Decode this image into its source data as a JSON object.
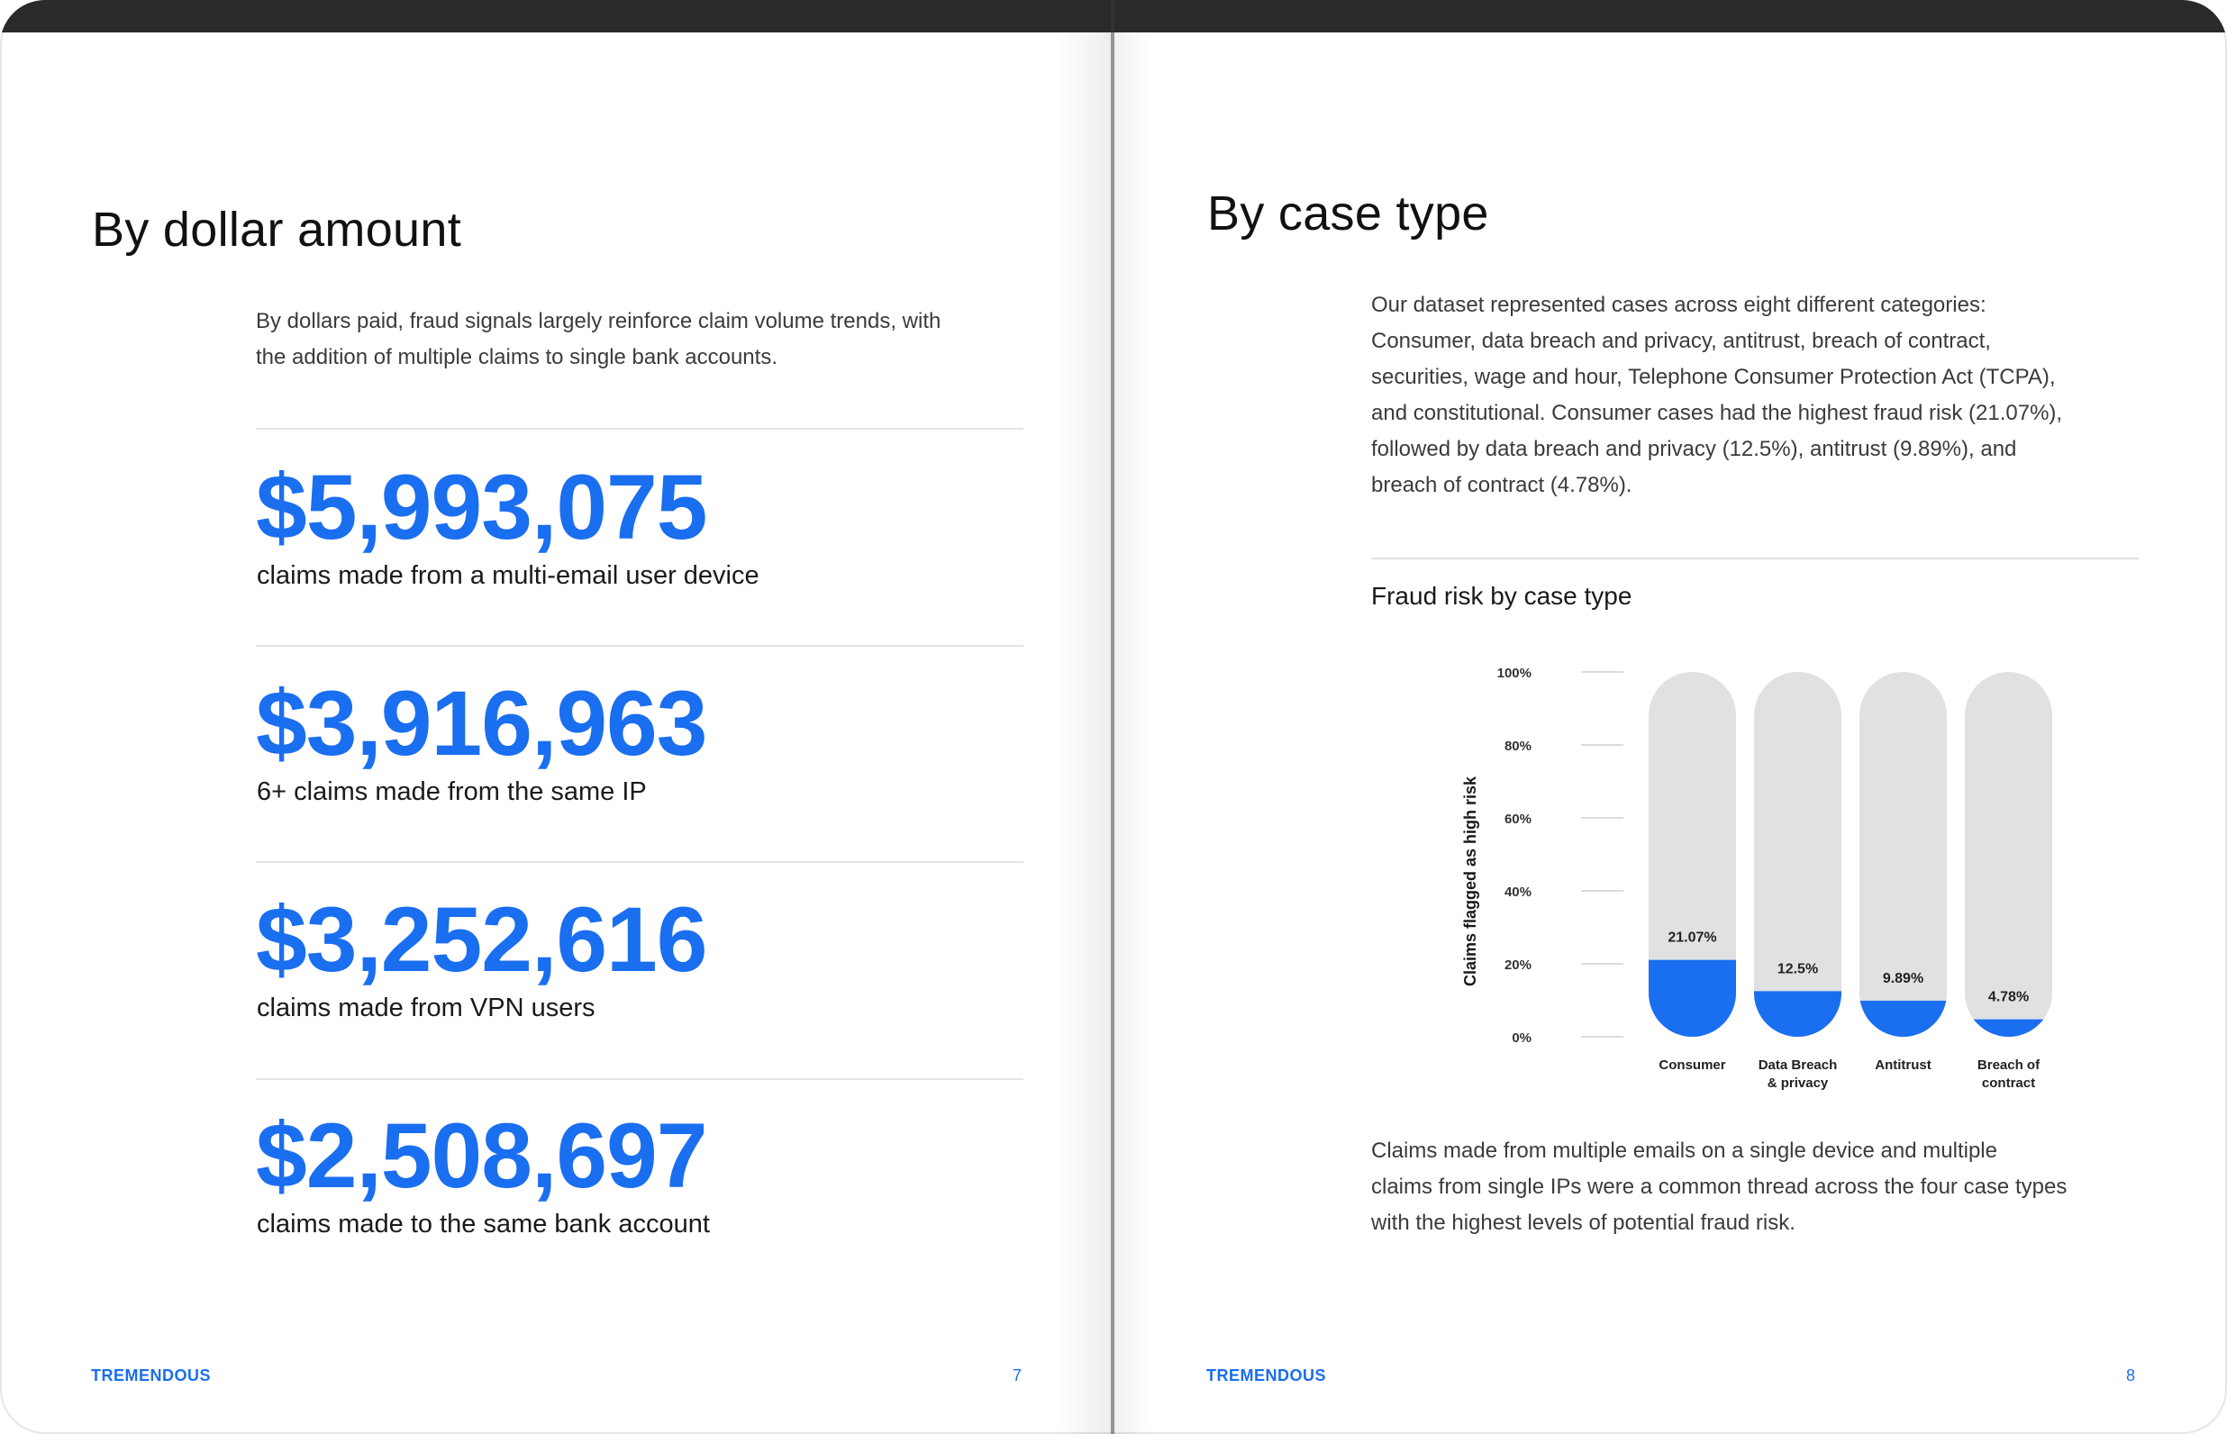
{
  "left_page": {
    "title": "By dollar amount",
    "intro_line1": "By dollars paid, fraud signals largely reinforce claim volume trends, with",
    "intro_line2": "the addition of multiple claims to single bank accounts.",
    "stats": [
      {
        "value": "$5,993,075",
        "label": "claims made from a multi-email user device"
      },
      {
        "value": "$3,916,963",
        "label": "6+ claims made from the same IP"
      },
      {
        "value": "$3,252,616",
        "label": "claims made from VPN users"
      },
      {
        "value": "$2,508,697",
        "label": "claims made to the same bank account"
      }
    ],
    "brand": "TREMENDOUS",
    "page_number": "7"
  },
  "right_page": {
    "title": "By case type",
    "intro_lines": [
      "Our dataset represented cases across eight different categories:",
      "Consumer, data breach and privacy, antitrust, breach of contract,",
      "securities, wage and hour, Telephone Consumer Protection Act (TCPA),",
      "and constitutional. Consumer cases had the highest fraud risk (21.07%),",
      "followed by data breach and privacy (12.5%), antitrust (9.89%), and",
      "breach of contract (4.78%)."
    ],
    "chart_heading": "Fraud risk by case type",
    "outro_lines": [
      "Claims made from multiple emails on a single device and multiple",
      "claims from single IPs were a common thread across the four case types",
      "with the highest levels of potential fraud risk."
    ],
    "brand": "TREMENDOUS",
    "page_number": "8"
  },
  "colors": {
    "accent": "#1a6ef0",
    "bar_track": "#e1e1e4",
    "topbar": "#2a2a2c"
  },
  "chart_data": {
    "type": "bar",
    "title": "",
    "ylabel": "Claims flagged as high risk",
    "xlabel": "",
    "ylim": [
      0,
      100
    ],
    "yticks": [
      "0%",
      "20%",
      "40%",
      "60%",
      "80%",
      "100%"
    ],
    "categories": [
      [
        "Consumer"
      ],
      [
        "Data Breach",
        "& privacy"
      ],
      [
        "Antitrust"
      ],
      [
        "Breach of",
        "contract"
      ]
    ],
    "values": [
      21.07,
      12.5,
      9.89,
      4.78
    ],
    "value_labels": [
      "21.07%",
      "12.5%",
      "9.89%",
      "4.78%"
    ],
    "grid": false
  }
}
